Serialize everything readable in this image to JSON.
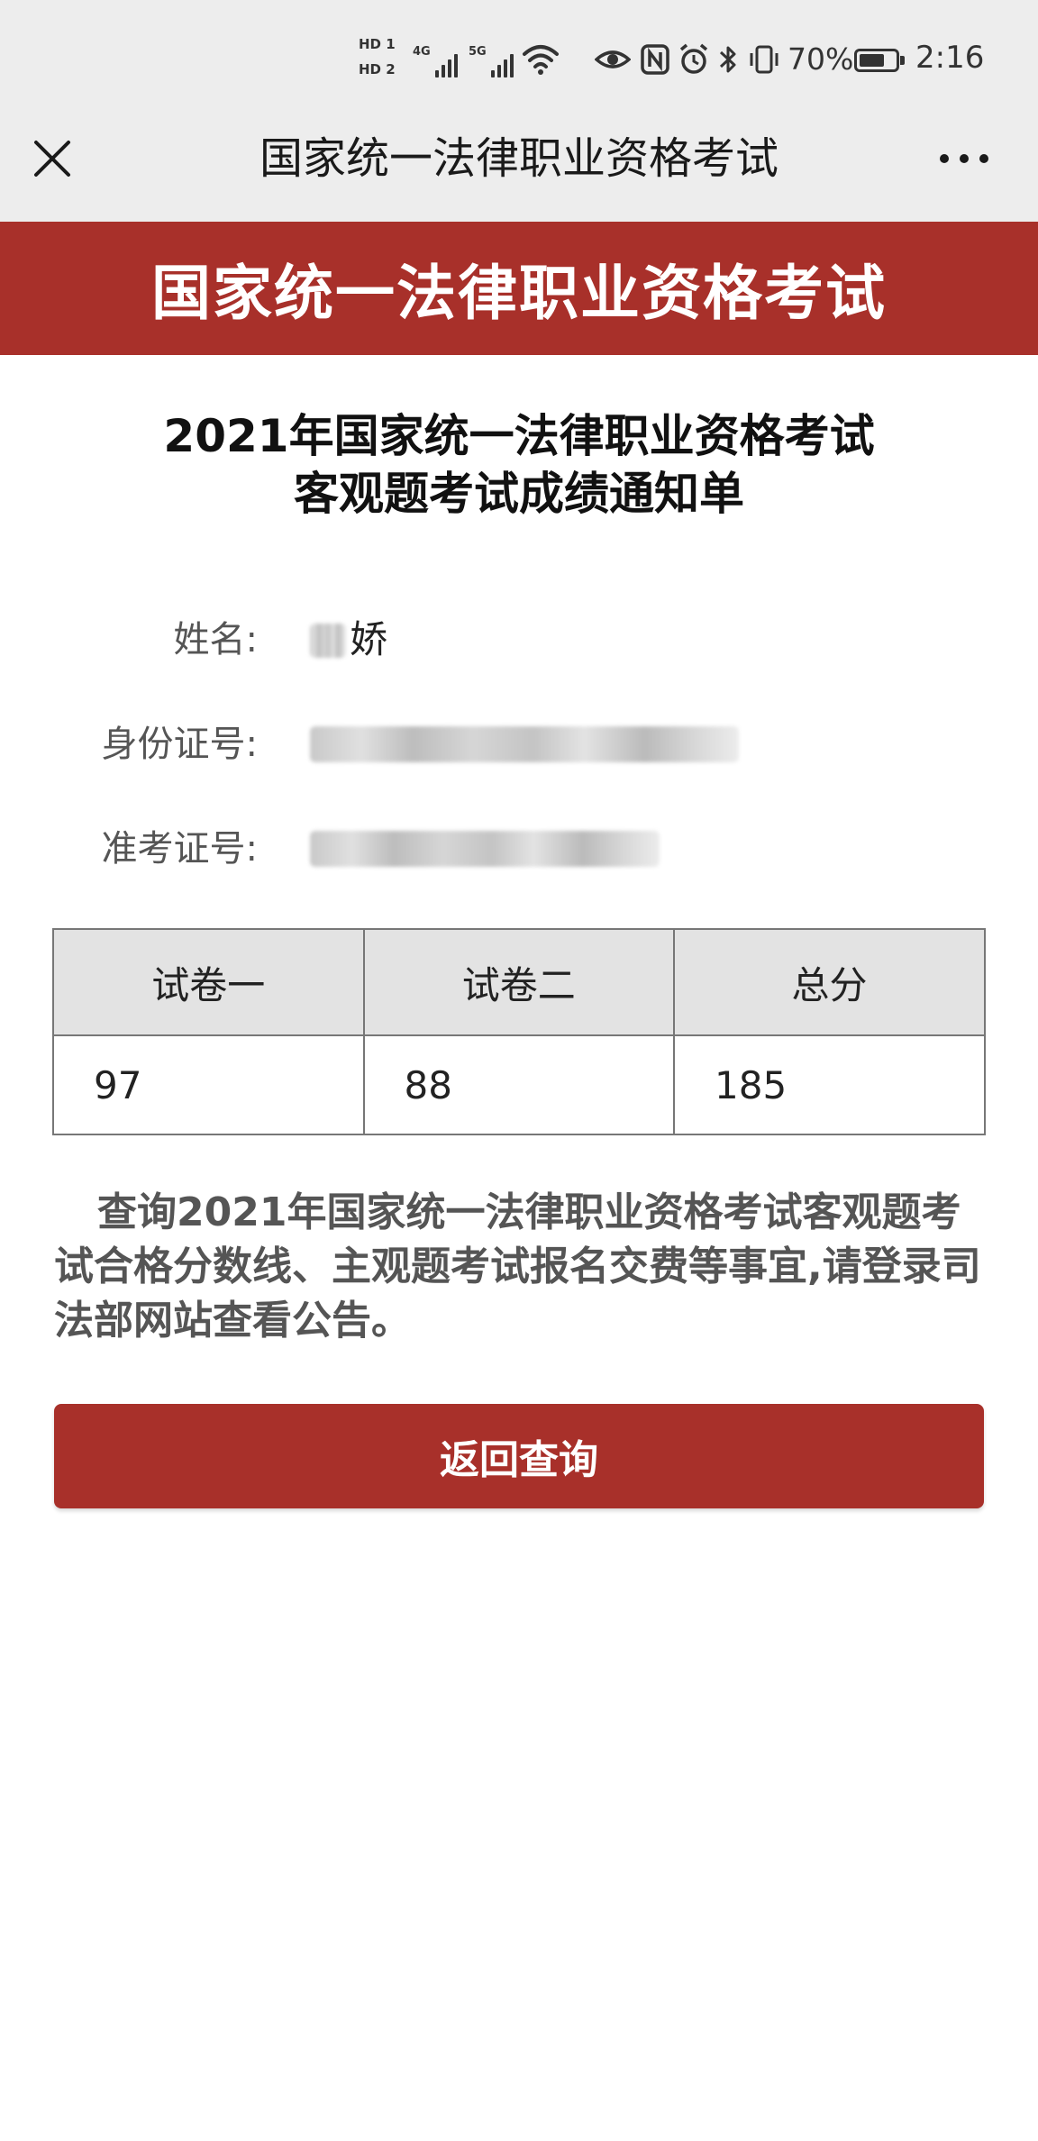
{
  "status_bar": {
    "hd1": "HD 1",
    "hd2": "HD 2",
    "net1": "4G",
    "net2": "5G",
    "battery_percent": "70%",
    "battery_level": 0.7,
    "time": "2:16",
    "icons": [
      "wifi-icon",
      "eye-icon",
      "nfc-icon",
      "alarm-icon",
      "bluetooth-icon",
      "vibrate-icon",
      "battery-icon"
    ]
  },
  "nav": {
    "title": "国家统一法律职业资格考试",
    "close_icon": "close-icon",
    "more_icon": "more-icon"
  },
  "banner": {
    "title": "国家统一法律职业资格考试"
  },
  "heading": {
    "line1": "2021年国家统一法律职业资格考试",
    "line2": "客观题考试成绩通知单"
  },
  "info": {
    "name_label": "姓名:",
    "name_value_visible": "娇",
    "id_label": "身份证号:",
    "ticket_label": "准考证号:"
  },
  "scores": {
    "headers": [
      "试卷一",
      "试卷二",
      "总分"
    ],
    "values": [
      "97",
      "88",
      "185"
    ]
  },
  "notice": "查询2021年国家统一法律职业资格考试客观题考试合格分数线、主观题考试报名交费等事宜,请登录司法部网站查看公告。",
  "button": {
    "label": "返回查询"
  },
  "colors": {
    "accent_red": "#a8302a",
    "header_gray": "#ededed",
    "table_header_gray": "#e3e3e3"
  }
}
